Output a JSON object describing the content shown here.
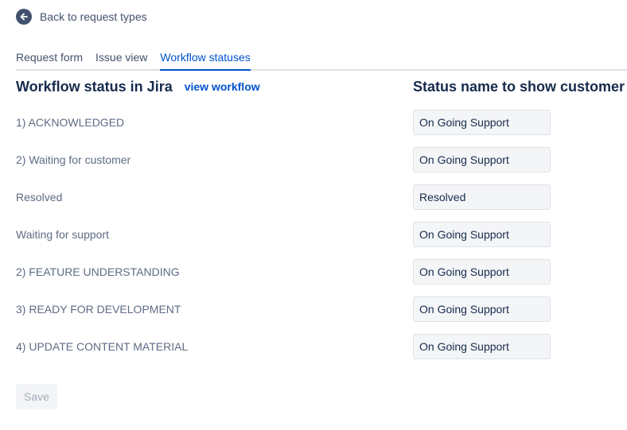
{
  "back_link": {
    "label": "Back to request types",
    "icon": "arrow-left-icon"
  },
  "tabs": [
    {
      "label": "Request form",
      "active": false
    },
    {
      "label": "Issue view",
      "active": false
    },
    {
      "label": "Workflow statuses",
      "active": true
    }
  ],
  "headers": {
    "left_title": "Workflow status in Jira",
    "view_workflow_link": "view workflow",
    "right_title": "Status name to show customer"
  },
  "statuses": [
    {
      "jira_status": "1) ACKNOWLEDGED",
      "customer_name": "On Going Support"
    },
    {
      "jira_status": "2) Waiting for customer",
      "customer_name": "On Going Support"
    },
    {
      "jira_status": "Resolved",
      "customer_name": "Resolved"
    },
    {
      "jira_status": "Waiting for support",
      "customer_name": "On Going Support"
    },
    {
      "jira_status": "2) FEATURE UNDERSTANDING",
      "customer_name": "On Going Support"
    },
    {
      "jira_status": "3) READY FOR DEVELOPMENT",
      "customer_name": "On Going Support"
    },
    {
      "jira_status": "4) UPDATE CONTENT MATERIAL",
      "customer_name": "On Going Support"
    }
  ],
  "save_button": {
    "label": "Save",
    "disabled": true
  },
  "colors": {
    "accent": "#0052cc",
    "heading": "#172b4d",
    "muted_text": "#5e6c84",
    "field_bg": "#f4f5f7",
    "divider": "#dfe1e6"
  }
}
